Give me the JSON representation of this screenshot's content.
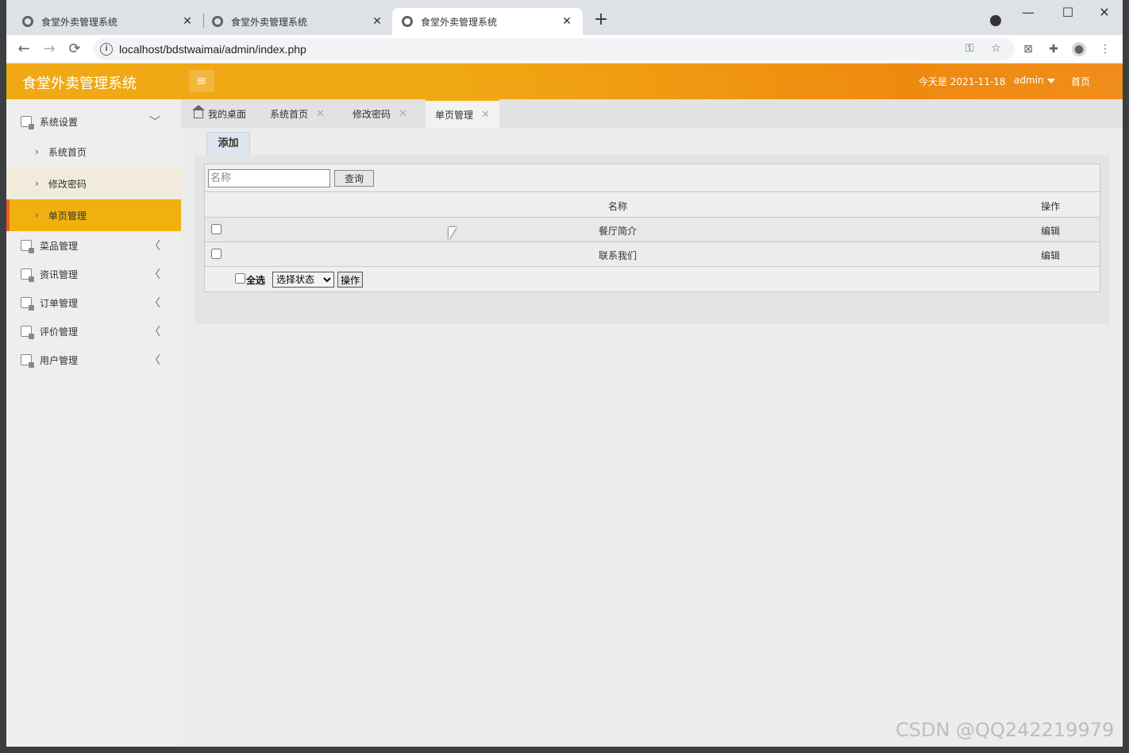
{
  "browser": {
    "tabs": [
      {
        "title": "食堂外卖管理系统",
        "close": "✕"
      },
      {
        "title": "食堂外卖管理系统",
        "close": "✕"
      },
      {
        "title": "食堂外卖管理系统",
        "close": "✕"
      }
    ],
    "new_tab": "+",
    "url": "localhost/bdstwaimai/admin/index.php",
    "back": "←",
    "forward": "→",
    "reload": "⟳",
    "minimize": "—",
    "maximize": "☐",
    "close": "✕"
  },
  "header": {
    "title": "食堂外卖管理系统",
    "menu_icon": "≡",
    "date_text": "今天是 2021-11-18",
    "user": "admin",
    "home_link": "首页"
  },
  "sidebar": {
    "groups": [
      {
        "label": "系统设置",
        "arrow": "﹀"
      },
      {
        "label": "菜品管理",
        "arrow": "〈"
      },
      {
        "label": "资讯管理",
        "arrow": "〈"
      },
      {
        "label": "订单管理",
        "arrow": "〈"
      },
      {
        "label": "评价管理",
        "arrow": "〈"
      },
      {
        "label": "用户管理",
        "arrow": "〈"
      }
    ],
    "sub_items": [
      {
        "label": "系统首页",
        "chev": "›"
      },
      {
        "label": "修改密码",
        "chev": "›"
      },
      {
        "label": "单页管理",
        "chev": "›"
      }
    ]
  },
  "content_tabs": [
    {
      "label": "我的桌面"
    },
    {
      "label": "系统首页",
      "close": "✕"
    },
    {
      "label": "修改密码",
      "close": "✕"
    },
    {
      "label": "单页管理",
      "close": "✕"
    }
  ],
  "main": {
    "add_label": "添加",
    "search": {
      "placeholder": "名称",
      "button": "查询"
    },
    "table": {
      "headers": {
        "name": "名称",
        "action": "操作"
      },
      "rows": [
        {
          "name": "餐厅简介",
          "action": "编辑"
        },
        {
          "name": "联系我们",
          "action": "编辑"
        }
      ]
    },
    "footer": {
      "select_all": "全选",
      "status_option": "选择状态",
      "operate": "操作"
    }
  },
  "watermark": "CSDN @QQ242219979",
  "colors": {
    "header_orange": "#f0a814",
    "active_yellow": "#f0b00e",
    "active_marker": "#e85d24"
  }
}
